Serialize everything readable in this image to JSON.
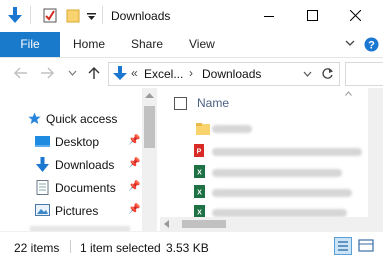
{
  "window": {
    "title": "Downloads"
  },
  "ribbon": {
    "file_label": "File",
    "tabs": [
      "Home",
      "Share",
      "View"
    ],
    "accent": "#1979ca"
  },
  "address": {
    "prefix": "«",
    "crumbs": [
      "Excel...",
      "Downloads"
    ],
    "separator": "›"
  },
  "navigation": {
    "items": [
      {
        "label": "Quick access",
        "icon": "star-icon",
        "pinned": false
      },
      {
        "label": "Desktop",
        "icon": "desktop-folder-icon",
        "pinned": true
      },
      {
        "label": "Downloads",
        "icon": "download-arrow-icon",
        "pinned": true
      },
      {
        "label": "Documents",
        "icon": "documents-icon",
        "pinned": true
      },
      {
        "label": "Pictures",
        "icon": "pictures-icon",
        "pinned": true
      }
    ]
  },
  "files": {
    "column_name": "Name",
    "rows": [
      {
        "icon": "folder-icon"
      },
      {
        "icon": "pdf-file-icon"
      },
      {
        "icon": "excel-file-icon"
      },
      {
        "icon": "excel-file-icon"
      },
      {
        "icon": "excel-file-icon"
      }
    ]
  },
  "status": {
    "items_count": "22 items",
    "selection": "1 item selected",
    "size": "3.53 KB"
  }
}
